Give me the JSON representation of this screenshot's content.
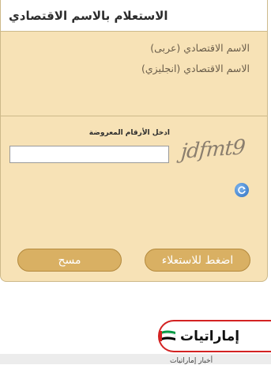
{
  "panel": {
    "title": "الاستعلام بالاسم الاقتصادي",
    "info_lines": [
      "الاسم الاقتصادي (عربى)",
      "الاسم الاقتصادي (انجليزي)"
    ]
  },
  "captcha": {
    "label": "ادخل الأرقام المعروضة",
    "input_value": "",
    "image_text": "jdfmt9",
    "refresh_icon": "refresh-icon"
  },
  "buttons": {
    "submit_label": "اضغط للاستعلاء",
    "clear_label": "مسح"
  },
  "brand": {
    "name": "إماراتيات",
    "flag_colors": [
      "#009a44",
      "#ffffff",
      "#000000",
      "#d32222"
    ]
  },
  "footer": {
    "partial_text": "أخبار إماراتيات"
  },
  "colors": {
    "panel_bg": "#f7e2b6",
    "button_bg": "#d9b063",
    "brand_red": "#d32222"
  }
}
